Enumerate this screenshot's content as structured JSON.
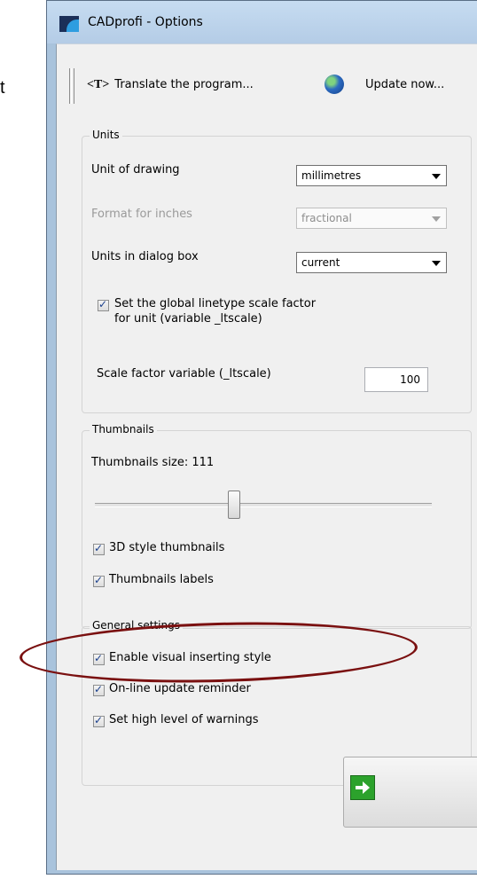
{
  "background_fragment": "t",
  "window": {
    "title": "CADprofi - Options"
  },
  "toolbar": {
    "translate_icon_label": "<T>",
    "translate_label": "Translate the program...",
    "update_label": "Update now..."
  },
  "units": {
    "legend": "Units",
    "unit_of_drawing": {
      "label": "Unit of drawing",
      "value": "millimetres"
    },
    "format_for_inches": {
      "label": "Format for inches",
      "value": "fractional",
      "enabled": false
    },
    "units_in_dialog": {
      "label": "Units in dialog box",
      "value": "current"
    },
    "global_linetype": {
      "label_line1": "Set the global linetype scale factor",
      "label_line2": "for unit (variable _ltscale)",
      "checked": true
    },
    "scale_factor": {
      "label": "Scale factor variable (_ltscale)",
      "value": "100"
    }
  },
  "thumbnails": {
    "legend": "Thumbnails",
    "size_label": "Thumbnails size: 111",
    "size_value": 111,
    "style_3d": {
      "label": "3D style thumbnails",
      "checked": true
    },
    "labels": {
      "label": "Thumbnails labels",
      "checked": true
    }
  },
  "general": {
    "legend": "General settings",
    "visual_inserting": {
      "label": "Enable visual inserting style",
      "checked": true
    },
    "online_update": {
      "label": "On-line update reminder",
      "checked": true
    },
    "high_warnings": {
      "label": "Set high level of warnings",
      "checked": true
    }
  },
  "colors": {
    "title_bar": "#b4cce6",
    "dialog_bg": "#f0f0f0",
    "highlight_ellipse": "#7a1010",
    "ok_icon": "#2ca22c"
  }
}
